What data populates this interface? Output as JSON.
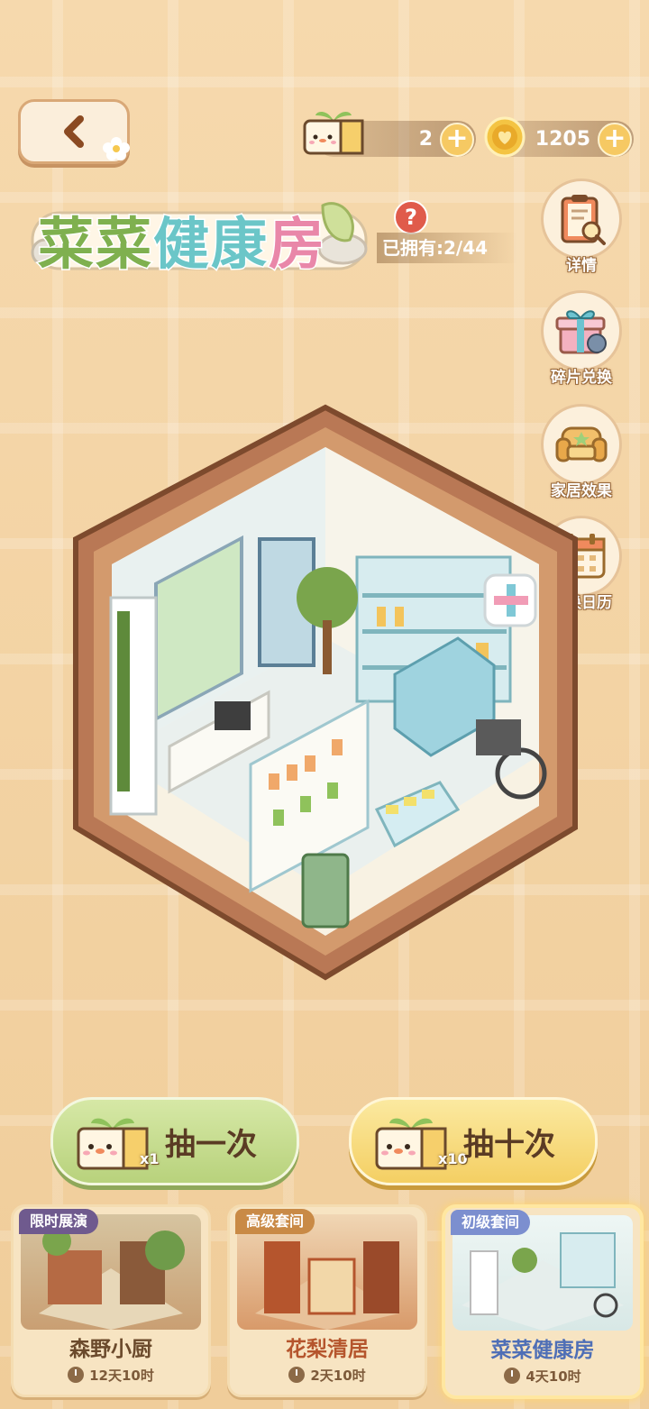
{
  "currency": {
    "tickets": "2",
    "coins": "1205"
  },
  "room": {
    "title_part1": "菜菜",
    "title_part2": "健康",
    "title_part3": "房",
    "owned": "已拥有:2/44"
  },
  "side_menu": [
    {
      "label": "详情",
      "icon": "clipboard-icon"
    },
    {
      "label": "碎片兑换",
      "icon": "gift-box-icon"
    },
    {
      "label": "家居效果",
      "icon": "sofa-icon"
    },
    {
      "label": "轮换日历",
      "icon": "calendar-icon"
    }
  ],
  "draw": {
    "one_label": "抽一次",
    "one_mult": "x1",
    "ten_label": "抽十次",
    "ten_mult": "x10"
  },
  "cards": [
    {
      "tag": "限时展演",
      "name": "森野小厨",
      "time": "12天10时",
      "name_color": "#6b4a2c",
      "tag_color": "#6f5a8e"
    },
    {
      "tag": "高级套间",
      "name": "花梨清居",
      "time": "2天10时",
      "name_color": "#b5552d",
      "tag_color": "#c98a46"
    },
    {
      "tag": "初级套间",
      "name": "菜菜健康房",
      "time": "4天10时",
      "name_color": "#4f6fb6",
      "tag_color": "#7c8fcf"
    }
  ],
  "colors": {
    "bg": "#f3d3a2",
    "frame": "#a5694a",
    "green_button": "#c4db8a",
    "yellow_button": "#f6d878"
  }
}
